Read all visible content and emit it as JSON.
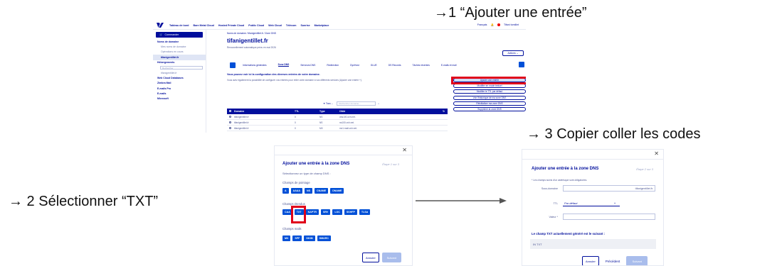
{
  "annotations": {
    "step1": "→1 “Ajouter une entrée”",
    "step2": "→ 2 Sélectionner “TXT”",
    "step3": "→ 3 Copier coller les codes"
  },
  "topbar": {
    "nav": [
      "Tableau de bord",
      "Bare Metal Cloud",
      "Hosted Private Cloud",
      "Public Cloud",
      "Web Cloud",
      "Télécom",
      "Sunrise",
      "Marketplace"
    ],
    "lang": "Français",
    "user": "Tifani tomillet"
  },
  "sidebar": {
    "command": "Commander",
    "items": [
      {
        "label": "Noms de domaine",
        "kind": "bold"
      },
      {
        "label": "Mes noms de domaine",
        "kind": "sub"
      },
      {
        "label": "Opérations en cours",
        "kind": "sub"
      },
      {
        "label": "tifanigentillet.fr",
        "kind": "active"
      },
      {
        "label": "Hébergements",
        "kind": "bold"
      },
      {
        "label": "Rechercher",
        "kind": "search"
      },
      {
        "label": "tifanigentillet.fr",
        "kind": "sub"
      },
      {
        "label": "Web Cloud Databases",
        "kind": "bold"
      },
      {
        "label": "Zimbra Mail",
        "kind": "bold"
      },
      {
        "label": "E-mails Pro",
        "kind": "bold"
      },
      {
        "label": "E-mails",
        "kind": "bold"
      },
      {
        "label": "Microsoft",
        "kind": "bold"
      }
    ]
  },
  "main": {
    "breadcrumb": "Noms de domaine / tifanigentillet.fr / Zone DNS",
    "title": "tifanigentillet.fr",
    "renewal": "Renouvellement automatique prévu en mai 2026",
    "actions": "Actions",
    "tabs": [
      "Informations générales",
      "Zone DNS",
      "Serveurs DNS",
      "Redirection",
      "DynHost",
      "GLUE",
      "DS Records",
      "Tâches récentes",
      "E-mails et mail"
    ],
    "info_title": "Vous pouvez voir ici la configuration des diverses entrées de votre domaine.",
    "info_text": "Vous avez également la possibilité de configurer vos entrées pour relier votre domaine à vos différents services (Ajouter une entrée +).",
    "buttons": [
      "Ajouter une entrée",
      "Modifier en mode textuel",
      "Modifier le TTL par défaut",
      "Voir l'historique de ma zone DNS",
      "Réinitialiser ma zone DNS",
      "Supprimer la zone DNS"
    ],
    "filter_label": "Tous",
    "filter_placeholder": "Rechercher domaine...",
    "table": {
      "headers": [
        "Domaine",
        "TTL",
        "Type",
        "Cible"
      ],
      "rows": [
        [
          "tifanigentillet.fr",
          "0",
          "NS",
          "dns100.ovh.net."
        ],
        [
          "tifanigentillet.fr",
          "0",
          "NS",
          "ns100.ovh.net."
        ],
        [
          "tifanigentillet.fr",
          "0",
          "MX",
          "mx1.mail.ovh.net."
        ]
      ]
    }
  },
  "dialog": {
    "title": "Ajouter une entrée à la zone DNS",
    "step": "Étape 1 sur 3",
    "subtitle": "Sélectionnez un type de champ DNS :",
    "group1": "Champs de pointage",
    "chips1": [
      "A",
      "AAAA",
      "NS",
      "CNAME",
      "DNAME"
    ],
    "group2": "Champs étendus",
    "chips2": [
      "CAA",
      "TXT",
      "NAPTR",
      "SRV",
      "LOC",
      "SSHFP",
      "TLSA"
    ],
    "group3": "Champs mails",
    "chips3": [
      "MX",
      "SPF",
      "DKIM",
      "DMARC"
    ],
    "cancel": "Annuler",
    "next": "Suivant"
  },
  "form": {
    "title": "Ajouter une entrée à la zone DNS",
    "step": "Étape 2 sur 3",
    "required": "* Les champs suivis d'un astérisque sont obligatoires.",
    "subdomain_label": "Sous-domaine",
    "subdomain_suffix": "tifanigentillet.fr.",
    "ttl_label": "TTL",
    "ttl_value": "Par défaut",
    "value_label": "Valeur *",
    "current_label": "Le champ TXT actuellement généré est le suivant :",
    "current_value": "IN TXT",
    "cancel": "Annuler",
    "previous": "Précédent",
    "next": "Suivant"
  },
  "colors": {
    "ovh_navy": "#000e9c",
    "ovh_blue": "#0050d7",
    "highlight_red": "#e0001a"
  }
}
